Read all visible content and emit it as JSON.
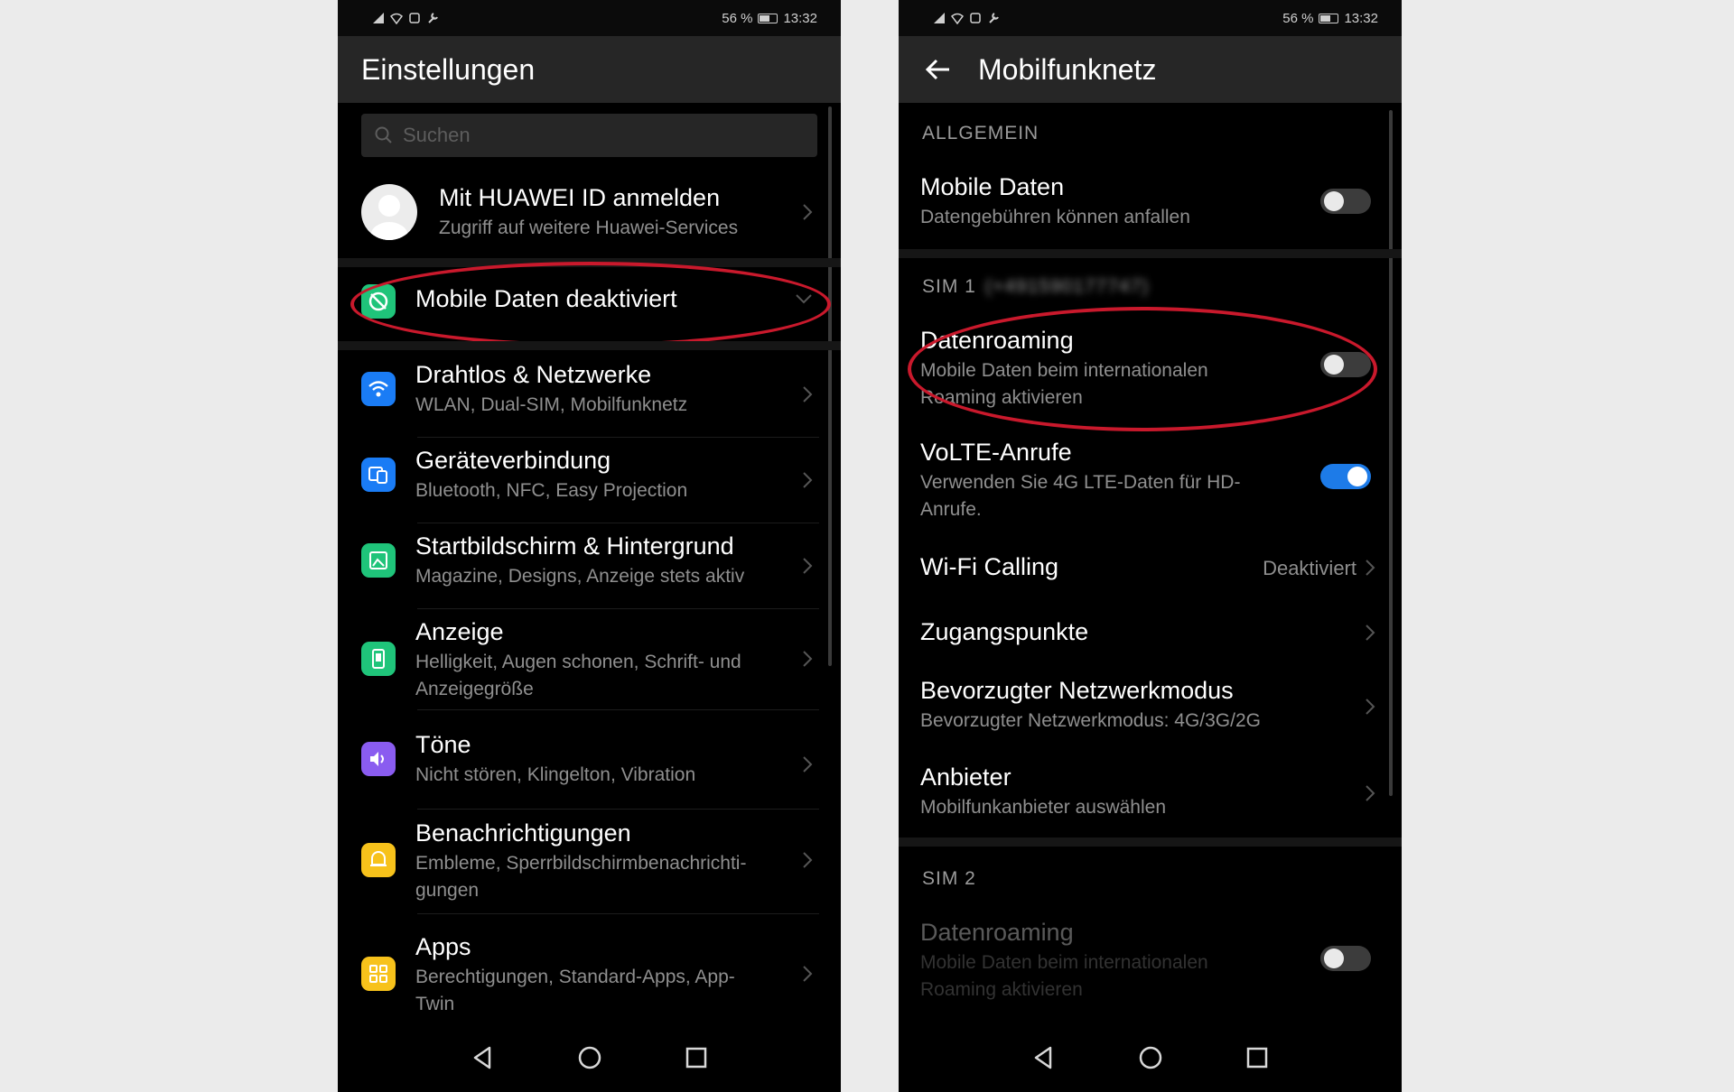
{
  "left": {
    "status": {
      "battery": "56 %",
      "time": "13:32"
    },
    "title": "Einstellungen",
    "search_placeholder": "Suchen",
    "account": {
      "title": "Mit HUAWEI ID anmelden",
      "subtitle": "Zugriff auf weitere Huawei-Services"
    },
    "alert": {
      "title": "Mobile Daten deaktiviert"
    },
    "items": [
      {
        "title": "Drahtlos & Netzwerke",
        "subtitle": "WLAN, Dual-SIM, Mobilfunknetz",
        "icon": "wifi-icon",
        "color": "#1a7cf5"
      },
      {
        "title": "Geräteverbindung",
        "subtitle": "Bluetooth, NFC, Easy Projection",
        "icon": "device-connection-icon",
        "color": "#1a7cf5"
      },
      {
        "title": "Startbildschirm & Hintergrund",
        "subtitle": "Magazine, Designs, Anzeige stets aktiv",
        "icon": "wallpaper-icon",
        "color": "#1fc47a"
      },
      {
        "title": "Anzeige",
        "subtitle": "Helligkeit, Augen schonen, Schrift- und Anzeigegröße",
        "icon": "display-icon",
        "color": "#1fc47a"
      },
      {
        "title": "Töne",
        "subtitle": "Nicht stören, Klingelton, Vibration",
        "icon": "sound-icon",
        "color": "#8a5cf0"
      },
      {
        "title": "Benachrichtigungen",
        "subtitle": "Embleme, Sperrbildschirmbenachrichti-gungen",
        "icon": "notification-icon",
        "color": "#f7c21b"
      },
      {
        "title": "Apps",
        "subtitle": "Berechtigungen, Standard-Apps, App-Twin",
        "icon": "apps-icon",
        "color": "#f7c21b"
      }
    ]
  },
  "right": {
    "status": {
      "battery": "56 %",
      "time": "13:32"
    },
    "title": "Mobilfunknetz",
    "sections": {
      "general": "ALLGEMEIN",
      "sim1": "SIM 1",
      "sim1_number": "(+491590177747)",
      "sim2": "SIM 2"
    },
    "mobile_data": {
      "title": "Mobile Daten",
      "subtitle": "Datengebühren können anfallen",
      "enabled": false
    },
    "roaming": {
      "title": "Datenroaming",
      "subtitle": "Mobile Daten beim internationalen Roaming aktivieren",
      "enabled": false
    },
    "volte": {
      "title": "VoLTE-Anrufe",
      "subtitle": "Verwenden Sie 4G LTE-Daten für HD-Anrufe.",
      "enabled": true
    },
    "wifi_calling": {
      "title": "Wi-Fi Calling",
      "value": "Deaktiviert"
    },
    "apn": {
      "title": "Zugangspunkte"
    },
    "network_mode": {
      "title": "Bevorzugter Netzwerkmodus",
      "subtitle": "Bevorzugter Netzwerkmodus: 4G/3G/2G"
    },
    "carrier": {
      "title": "Anbieter",
      "subtitle": "Mobilfunkanbieter auswählen"
    },
    "sim2_roaming": {
      "title": "Datenroaming",
      "subtitle": "Mobile Daten beim internationalen Roaming aktivieren",
      "enabled": false
    }
  },
  "colors": {
    "highlight": "#c9192c",
    "toggle_on": "#1d7be8"
  }
}
